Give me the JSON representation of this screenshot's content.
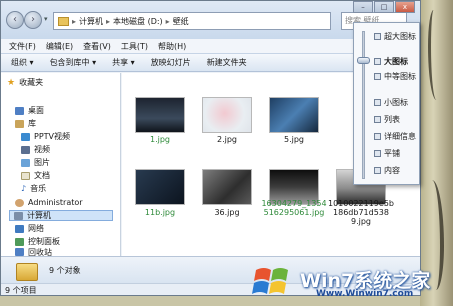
{
  "address": {
    "segments": [
      "计算机",
      "本地磁盘 (D:)",
      "壁纸"
    ],
    "search_placeholder": "搜索 壁纸"
  },
  "window_controls": {
    "min": "–",
    "max": "□",
    "close": "x"
  },
  "menubar": [
    "文件(F)",
    "编辑(E)",
    "查看(V)",
    "工具(T)",
    "帮助(H)"
  ],
  "commandbar": [
    "组织 ▾",
    "包含到库中 ▾",
    "共享 ▾",
    "放映幻灯片",
    "新建文件夹"
  ],
  "nav": {
    "items": [
      {
        "label": "收藏夹",
        "icon": "star-icon"
      },
      {
        "label": "桌面",
        "icon": "desktop-icon"
      },
      {
        "label": "库",
        "icon": "library-icon"
      },
      {
        "label": "PPTV视频",
        "icon": "pptv-icon"
      },
      {
        "label": "视频",
        "icon": "video-icon"
      },
      {
        "label": "图片",
        "icon": "picture-icon"
      },
      {
        "label": "文档",
        "icon": "document-icon"
      },
      {
        "label": "音乐",
        "icon": "music-icon"
      },
      {
        "label": "Administrator",
        "icon": "user-icon"
      },
      {
        "label": "计算机",
        "icon": "computer-icon"
      },
      {
        "label": "网络",
        "icon": "network-icon"
      },
      {
        "label": "控制面板",
        "icon": "control-panel-icon"
      },
      {
        "label": "回收站",
        "icon": "recycle-bin-icon"
      }
    ]
  },
  "files": [
    {
      "name": "1.jpg",
      "color": "#2f8a3a"
    },
    {
      "name": "2.jpg",
      "color": "#1a1a1a"
    },
    {
      "name": "5.jpg",
      "color": "#1a1a1a"
    },
    {
      "name": "11b.jpg",
      "color": "#2f8a3a"
    },
    {
      "name": "36.jpg",
      "color": "#1a1a1a"
    },
    {
      "name": "16304279_1354516295061.jpg",
      "color": "#2f8a3a"
    },
    {
      "name": "1010022119e5b186db71d5389.jpg",
      "color": "#1a1a1a"
    }
  ],
  "file_lines": {
    "f6a": "16304279_1354",
    "f6b": "516295061.jpg",
    "f7a": "1010022119e5b",
    "f7b": "186db71d538",
    "f7c": "9.jpg"
  },
  "viewmenu": {
    "items": [
      "超大图标",
      "大图标",
      "中等图标",
      "小图标",
      "列表",
      "详细信息",
      "平铺",
      "内容"
    ],
    "selected": "大图标"
  },
  "details": {
    "count": "9 个对象"
  },
  "status": {
    "text": "9 个项目"
  },
  "watermark": {
    "brand": "Win7系统之家",
    "url": "Www.Winwin7.com"
  }
}
